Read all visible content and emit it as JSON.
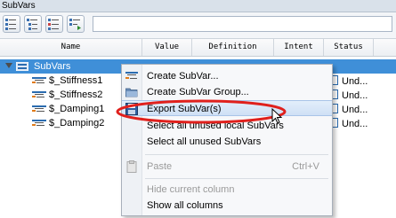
{
  "panel": {
    "title": "SubVars"
  },
  "toolbar": {
    "buttons": [
      {
        "name": "add-subvar-button",
        "icon": "list-add-icon"
      },
      {
        "name": "add-group-button",
        "icon": "list-group-icon"
      },
      {
        "name": "remove-subvar-button",
        "icon": "list-remove-icon"
      },
      {
        "name": "move-subvar-button",
        "icon": "list-arrow-icon"
      }
    ],
    "search_value": ""
  },
  "columns": [
    "Name",
    "Value",
    "Definition",
    "Intent",
    "Status"
  ],
  "tree": {
    "root": "SubVars",
    "items": [
      {
        "name": "$_Stiffness1",
        "status": "Und..."
      },
      {
        "name": "$_Stiffness2",
        "status": "Und..."
      },
      {
        "name": "$_Damping1",
        "status": "Und..."
      },
      {
        "name": "$_Damping2",
        "status": "Und..."
      }
    ]
  },
  "context_menu": {
    "items": [
      {
        "label": "Create SubVar...",
        "icon": "subvar-icon",
        "enabled": true
      },
      {
        "label": "Create SubVar Group...",
        "icon": "folder-icon",
        "enabled": true
      },
      {
        "label": "Export SubVar(s)",
        "icon": "save-disk-icon",
        "enabled": true,
        "highlighted": true
      },
      {
        "label": "Select all unused local SubVars",
        "enabled": true
      },
      {
        "label": "Select all unused SubVars",
        "enabled": true
      },
      {
        "label": "Paste",
        "icon": "paste-icon",
        "enabled": false,
        "shortcut": "Ctrl+V"
      },
      {
        "label": "Hide current column",
        "enabled": false
      },
      {
        "label": "Show all columns",
        "enabled": true
      }
    ]
  },
  "colors": {
    "selection": "#3f8fd8",
    "annotation": "#e0201c",
    "status_accent": "#2b6cb0"
  }
}
